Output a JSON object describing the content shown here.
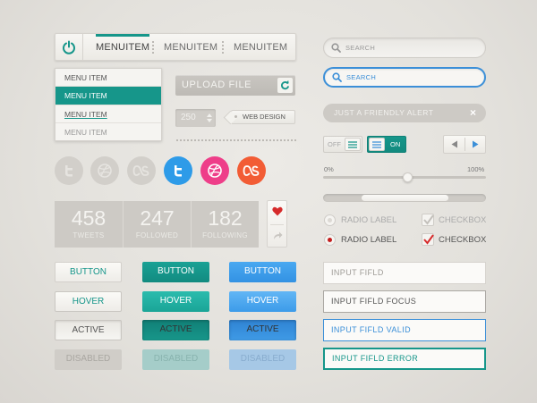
{
  "nav": {
    "items": [
      "MENUITEM",
      "MENUITEM",
      "MENUITEM"
    ]
  },
  "dropdown": {
    "items": [
      "MENU ITEM",
      "MENU ITEM",
      "MENU ITEM",
      "MENU ITEM"
    ]
  },
  "upload": {
    "label": "UPLOAD FILE"
  },
  "stepper": {
    "value": "250"
  },
  "tag": {
    "label": "WEB DESIGN"
  },
  "social": {
    "icons": [
      "twitter-icon",
      "dribbble-icon",
      "lastfm-icon"
    ],
    "colors": {
      "twitter": "#2e9be8",
      "dribbble": "#ee3e89",
      "lastfm": "#f25c35"
    }
  },
  "stats": [
    {
      "value": "458",
      "label": "TWEETS"
    },
    {
      "value": "247",
      "label": "FOLLOWED"
    },
    {
      "value": "182",
      "label": "FOLLOWING"
    }
  ],
  "buttons": {
    "normal": "BUTTON",
    "hover": "HOVER",
    "active": "ACTIVE",
    "disabled": "DISABLED"
  },
  "search": {
    "placeholder": "SEARCH",
    "placeholder_focus": "SEARCH"
  },
  "alert": {
    "text": "JUST A FRIENDLY ALERT",
    "close": "×"
  },
  "toggles": {
    "off": "OFF",
    "on": "ON"
  },
  "slider": {
    "min_label": "0%",
    "max_label": "100%",
    "value": 0.52
  },
  "scrollbar": {
    "position": 0.24,
    "size": 0.53
  },
  "options": {
    "radio_label": "RADIO LABEL",
    "checkbox_label": "CHECKBOX"
  },
  "inputs": [
    {
      "text": "INPUT FIFLD"
    },
    {
      "text": "INPUT FIFLD FOCUS"
    },
    {
      "text": "INPUT FIFLD VALID"
    },
    {
      "text": "INPUT FIFLD ERROR"
    }
  ],
  "colors": {
    "teal": "#16968a",
    "blue": "#3b8fd8",
    "red": "#d62b2b"
  }
}
